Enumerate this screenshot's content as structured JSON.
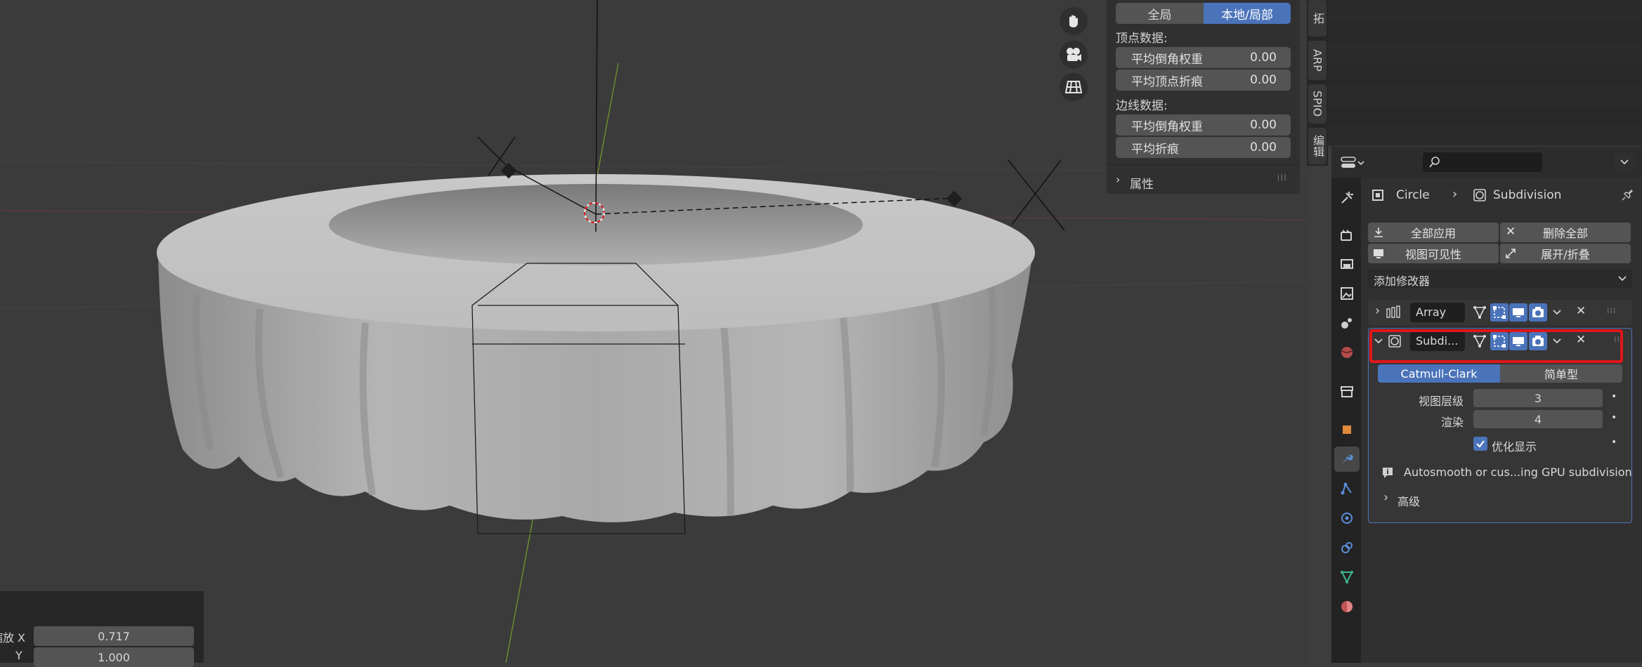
{
  "viewport": {
    "nav_icons": [
      "hand-icon",
      "camera-icon",
      "grid-icon"
    ]
  },
  "n_panel": {
    "seg_global": "全局",
    "seg_local": "本地/局部",
    "vertex_data_label": "顶点数据:",
    "vertex_rows": [
      {
        "label": "平均倒角权重",
        "value": "0.00"
      },
      {
        "label": "平均顶点折痕",
        "value": "0.00"
      }
    ],
    "edge_data_label": "边线数据:",
    "edge_rows": [
      {
        "label": "平均倒角权重",
        "value": "0.00"
      },
      {
        "label": "平均折痕",
        "value": "0.00"
      }
    ],
    "properties_label": "属性"
  },
  "side_tabs": [
    "拓",
    "ARP",
    "SPIO",
    "编辑"
  ],
  "last_operator": {
    "scale_x_label": "缩放 X",
    "scale_x_value": "0.717",
    "scale_y_label": "Y",
    "scale_y_value": "1.000"
  },
  "properties": {
    "breadcrumb_object": "Circle",
    "breadcrumb_modifier": "Subdivision",
    "apply_all": "全部应用",
    "delete_all": "删除全部",
    "viewport_vis": "视图可见性",
    "expand_collapse": "展开/折叠",
    "add_modifier": "添加修改器",
    "modifiers": [
      {
        "name": "Array",
        "expanded": false
      },
      {
        "name": "Subdi...",
        "expanded": true
      }
    ],
    "subdiv": {
      "type_catmull": "Catmull-Clark",
      "type_simple": "简单型",
      "levels_viewport_label": "视图层级",
      "levels_viewport_value": "3",
      "render_label": "渲染",
      "render_value": "4",
      "optimal_display_label": "优化显示",
      "optimal_display_checked": true,
      "info_text": "Autosmooth or cus...ing GPU subdivision",
      "advanced_label": "高级"
    },
    "accent_color": "#4a73ba",
    "highlight_color": "#e0161a"
  }
}
